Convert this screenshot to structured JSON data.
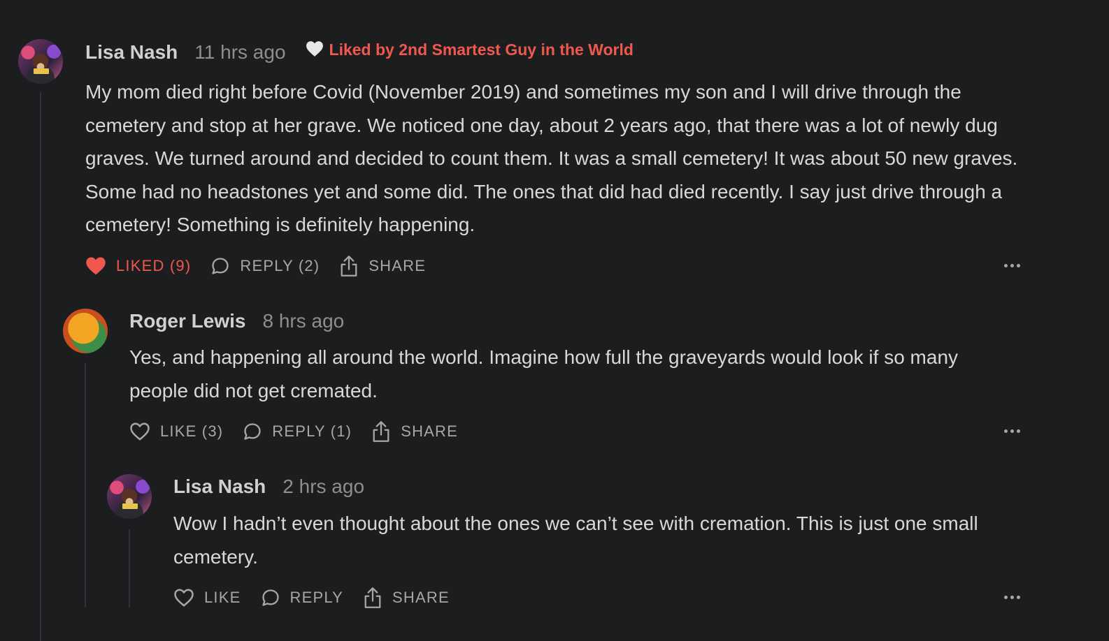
{
  "comments": [
    {
      "author": "Lisa Nash",
      "time": "11 hrs ago",
      "liked_by": "Liked by 2nd Smartest Guy in the World",
      "body": "My mom died right before Covid (November 2019) and sometimes my son and I will drive through the cemetery and stop at her grave. We noticed one day, about 2 years ago, that there was a lot of newly dug graves. We turned around and decided to count them. It was a small cemetery! It was about 50 new graves. Some had no headstones yet and some did. The ones that did had died recently. I say just drive through a cemetery! Something is definitely happening.",
      "like_label": "LIKED (9)",
      "reply_label": "REPLY (2)",
      "share_label": "SHARE"
    },
    {
      "author": "Roger Lewis",
      "time": "8 hrs ago",
      "body": "Yes, and happening all around the world. Imagine how full the graveyards would look if so many people did not get cremated.",
      "like_label": "LIKE (3)",
      "reply_label": "REPLY (1)",
      "share_label": "SHARE"
    },
    {
      "author": "Lisa Nash",
      "time": "2 hrs ago",
      "body": "Wow I hadn’t even thought about the ones we can’t see with cremation. This is just one small cemetery.",
      "like_label": "LIKE",
      "reply_label": "REPLY",
      "share_label": "SHARE"
    }
  ],
  "colors": {
    "background": "#1c1d1f",
    "accent_red": "#f0584d",
    "text": "#d8d8d8",
    "muted": "#8e8e8e"
  },
  "icons": [
    "heart-icon",
    "heart-filled-icon",
    "reply-bubble-icon",
    "share-icon",
    "more-dots-icon"
  ]
}
